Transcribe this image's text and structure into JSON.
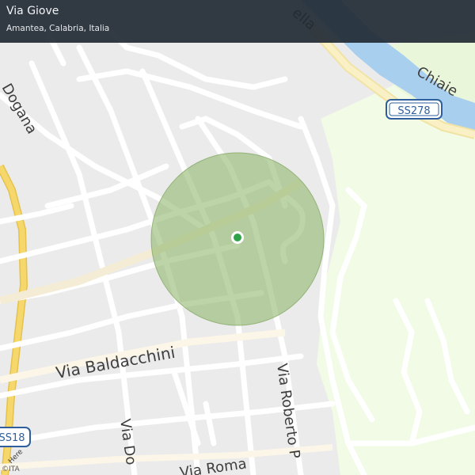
{
  "header": {
    "title": "Via Giove",
    "subtitle": "Amantea, Calabria, Italia"
  },
  "map": {
    "streets": {
      "dogana": "Dogana",
      "baldacchini": "Via  Baldacchini",
      "roberto": "Via Roberto P",
      "do": "Via Do",
      "roma": "Via Roma",
      "chiaie": "Chiaie",
      "ella": "ella",
      "here": "Here"
    },
    "shields": {
      "ss278": "SS278",
      "ss18": "SS18"
    },
    "location_marker": "current-location",
    "accuracy_circle_color": "#8db56a",
    "location_dot_color": "#2ea34a",
    "river_color": "#a9cfee",
    "green_area_color": "#f2fbe6",
    "highway_color": "#f6d76b"
  },
  "copyright": "©ITA"
}
